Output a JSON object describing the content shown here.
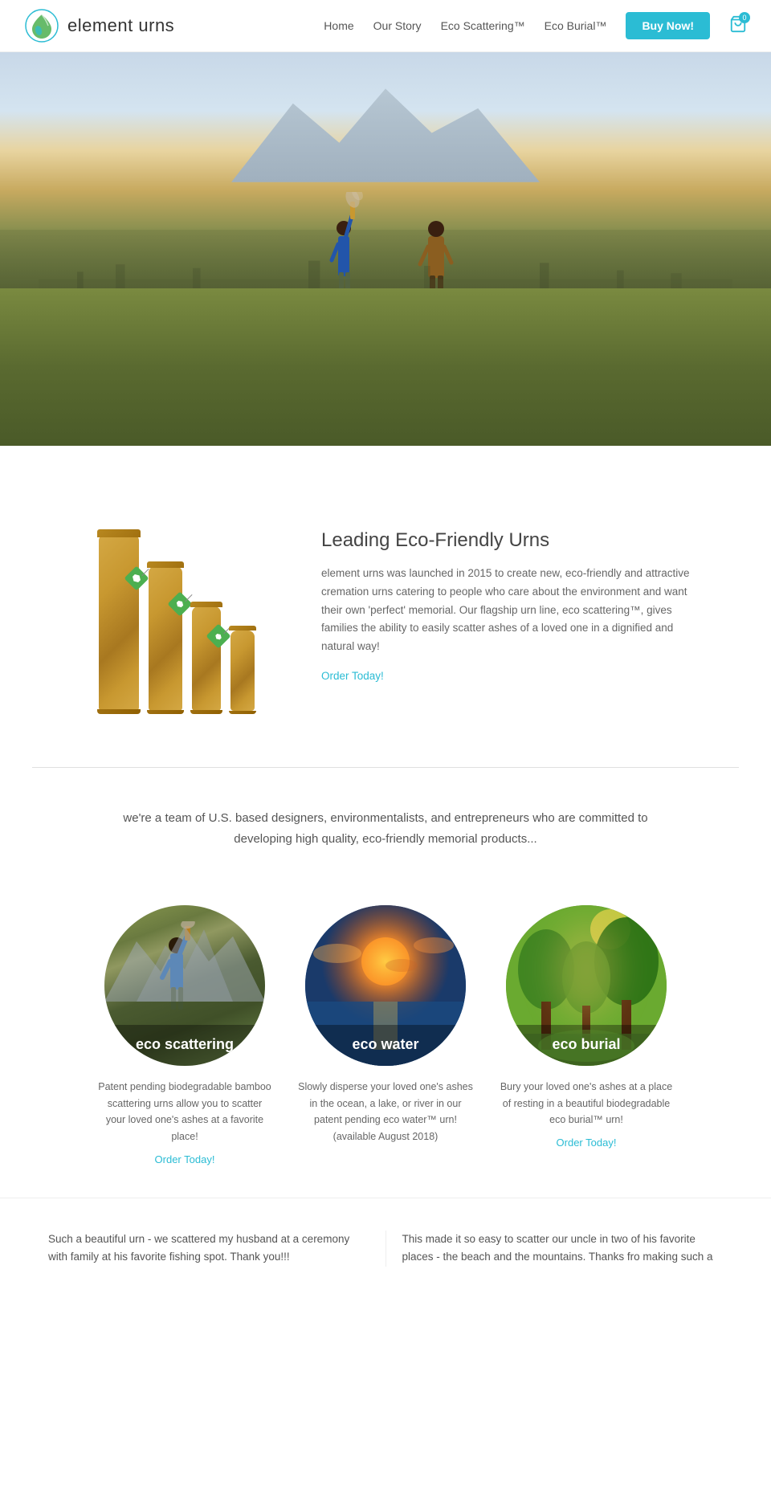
{
  "header": {
    "logo_text": "element urns",
    "nav": {
      "home": "Home",
      "our_story": "Our Story",
      "eco_scattering": "Eco Scattering™",
      "eco_burial": "Eco Burial™",
      "buy_now": "Buy Now!",
      "cart_count": "0"
    }
  },
  "hero": {
    "alt": "Two people scattering ashes over a city from a hilltop"
  },
  "section_urns": {
    "title": "Leading Eco-Friendly Urns",
    "body": "element urns was launched in 2015 to create new, eco-friendly and attractive cremation urns catering to people who care about the environment and want their own 'perfect' memorial. Our flagship urn line, eco scattering™, gives families the ability to easily scatter ashes of a loved one in a dignified and natural way!",
    "order_link": "Order Today!"
  },
  "section_team": {
    "tagline": "we're a team of U.S. based designers, environmentalists, and entrepreneurs who are committed to developing high quality, eco-friendly memorial products..."
  },
  "circles": [
    {
      "label": "eco scattering",
      "description": "Patent pending biodegradable bamboo scattering urns allow you to scatter your loved one's ashes at a favorite place!",
      "link": "Order Today!",
      "type": "scatter"
    },
    {
      "label": "eco water",
      "description": "Slowly disperse your loved one's ashes in the ocean, a lake, or river in our patent pending eco water™ urn! (available August 2018)",
      "link": null,
      "type": "water"
    },
    {
      "label": "eco burial",
      "description": "Bury your loved one's ashes at a place of resting in a beautiful biodegradable eco burial™ urn!",
      "link": "Order Today!",
      "type": "burial"
    }
  ],
  "testimonials": [
    {
      "text": "Such a beautiful urn - we scattered my husband at a ceremony with family at his favorite fishing spot. Thank you!!!"
    },
    {
      "text": "This made it so easy to scatter our uncle in two of his favorite places - the beach and the mountains. Thanks fro making such a"
    }
  ]
}
